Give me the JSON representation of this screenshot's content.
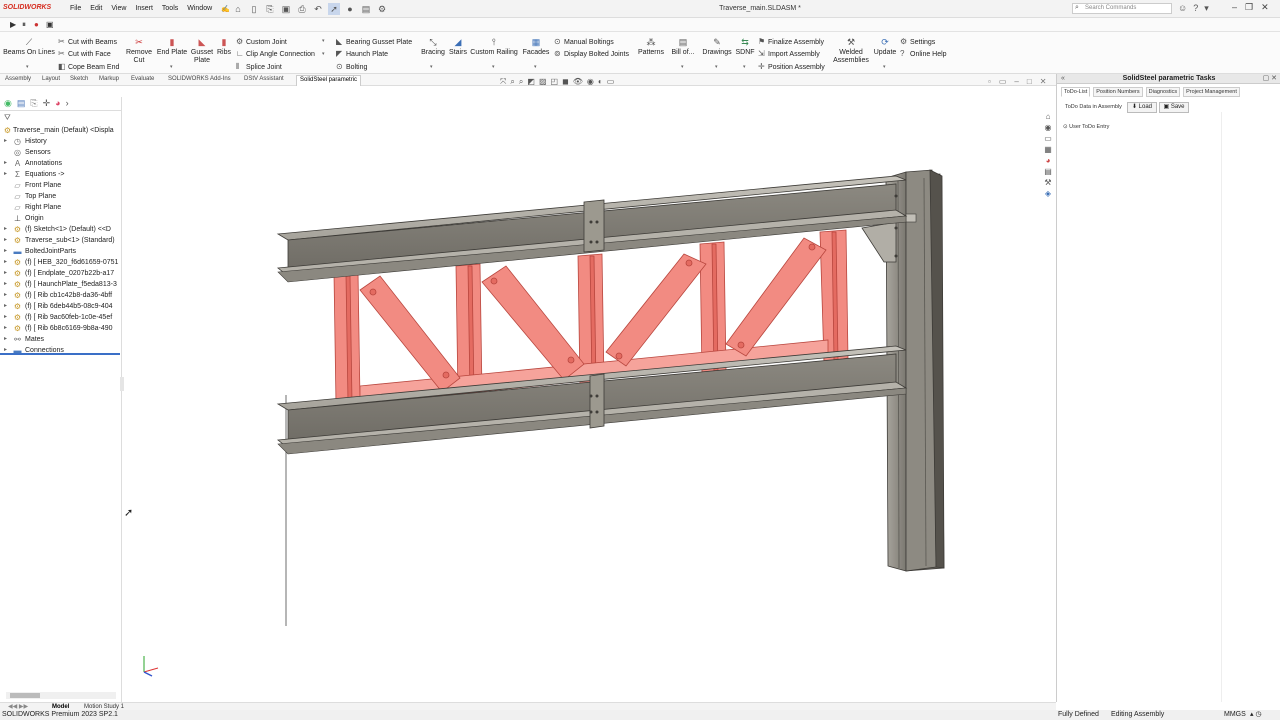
{
  "app": {
    "logo": "SOLIDWORKS",
    "title": "Traverse_main.SLDASM *",
    "menus": [
      "File",
      "Edit",
      "View",
      "Insert",
      "Tools",
      "Window"
    ],
    "search_placeholder": "Search Commands"
  },
  "ribbon": {
    "beams_on_lines": "Beams On Lines",
    "cut_with_beams": "Cut with Beams",
    "cut_with_face": "Cut with Face",
    "cope_beam_end": "Cope Beam End",
    "remove_cut_1": "Remove",
    "remove_cut_2": "Cut",
    "end_plate": "End Plate",
    "gusset_plate_1": "Gusset",
    "gusset_plate_2": "Plate",
    "ribs": "Ribs",
    "custom_joint": "Custom Joint",
    "clip_angle_connection": "Clip Angle Connection",
    "splice_joint": "Splice Joint",
    "bearing_gusset_plate": "Bearing Gusset Plate",
    "haunch_plate": "Haunch Plate",
    "bolting": "Bolting",
    "bracing": "Bracing",
    "stairs": "Stairs",
    "custom_railing": "Custom Railing",
    "facades": "Facades",
    "manual_boltings": "Manual Boltings",
    "display_bolted_joints": "Display Bolted Joints",
    "patterns": "Patterns",
    "bill_of": "Bill of...",
    "drawings": "Drawings",
    "sdnf": "SDNF",
    "finalize_assembly": "Finalize Assembly",
    "import_assembly": "Import Assembly",
    "position_assembly": "Position Assembly",
    "welded_1": "Welded",
    "welded_2": "Assemblies",
    "update": "Update",
    "settings": "Settings",
    "online_help": "Online Help"
  },
  "tabs": [
    "Assembly",
    "Layout",
    "Sketch",
    "Markup",
    "Evaluate",
    "SOLIDWORKS Add-Ins",
    "DStV Assistant",
    "SolidSteel parametric"
  ],
  "active_tab": "SolidSteel parametric",
  "tree": {
    "root": "Traverse_main (Default) <Displa",
    "items": [
      {
        "label": "History",
        "icon": "history-icon",
        "arrow": true
      },
      {
        "label": "Sensors",
        "icon": "sensor-icon",
        "arrow": false
      },
      {
        "label": "Annotations",
        "icon": "annotation-icon",
        "arrow": true
      },
      {
        "label": "Equations ->",
        "icon": "equation-icon",
        "arrow": true
      },
      {
        "label": "Front Plane",
        "icon": "plane-icon",
        "arrow": false
      },
      {
        "label": "Top Plane",
        "icon": "plane-icon",
        "arrow": false
      },
      {
        "label": "Right Plane",
        "icon": "plane-icon",
        "arrow": false
      },
      {
        "label": "Origin",
        "icon": "origin-icon",
        "arrow": false
      },
      {
        "label": "(f) Sketch<1> (Default) <<D",
        "icon": "part-icon",
        "arrow": true
      },
      {
        "label": "Traverse_sub<1> (Standard)",
        "icon": "assembly-icon",
        "arrow": true
      },
      {
        "label": "BoltedJointParts",
        "icon": "folder-icon",
        "arrow": true
      },
      {
        "label": "(f) [ HEB_320_f6d61659-0751",
        "icon": "part-icon",
        "arrow": true
      },
      {
        "label": "(f) [ Endplate_0207b22b-a17",
        "icon": "part-icon",
        "arrow": true
      },
      {
        "label": "(f) [ HaunchPlate_f5eda813-3",
        "icon": "part-icon",
        "arrow": true
      },
      {
        "label": "(f) [ Rib cb1c42b8-da36-4bff",
        "icon": "part-icon",
        "arrow": true
      },
      {
        "label": "(f) [ Rib 6deb44b5-08c9-404",
        "icon": "part-icon",
        "arrow": true
      },
      {
        "label": "(f) [ Rib 9ac60feb-1c0e-45ef",
        "icon": "part-icon",
        "arrow": true
      },
      {
        "label": "(f) [ Rib 6b8c6169-9b8a-490",
        "icon": "part-icon",
        "arrow": true
      },
      {
        "label": "Mates",
        "icon": "mates-icon",
        "arrow": true
      },
      {
        "label": "Connections",
        "icon": "folder-icon",
        "arrow": true
      }
    ]
  },
  "panel": {
    "title": "SolidSteel parametric Tasks",
    "tabs": [
      "ToDo-List",
      "Position Numbers",
      "Diagnostics",
      "Project Management"
    ],
    "todo_label": "ToDo Data in Assembly",
    "load": "Load",
    "save": "Save",
    "user_entry": "User ToDo Entry"
  },
  "bottom_tabs": [
    "Model",
    "Motion Study 1"
  ],
  "status": {
    "left": "SOLIDWORKS Premium 2023 SP2.1",
    "fully_defined": "Fully Defined",
    "editing": "Editing Assembly",
    "units": "MMGS"
  },
  "colors": {
    "steel": "#a5a29a",
    "rib": "#f28b82",
    "highlight_line": "#3a6fc7",
    "brand": "#d52b1e"
  }
}
